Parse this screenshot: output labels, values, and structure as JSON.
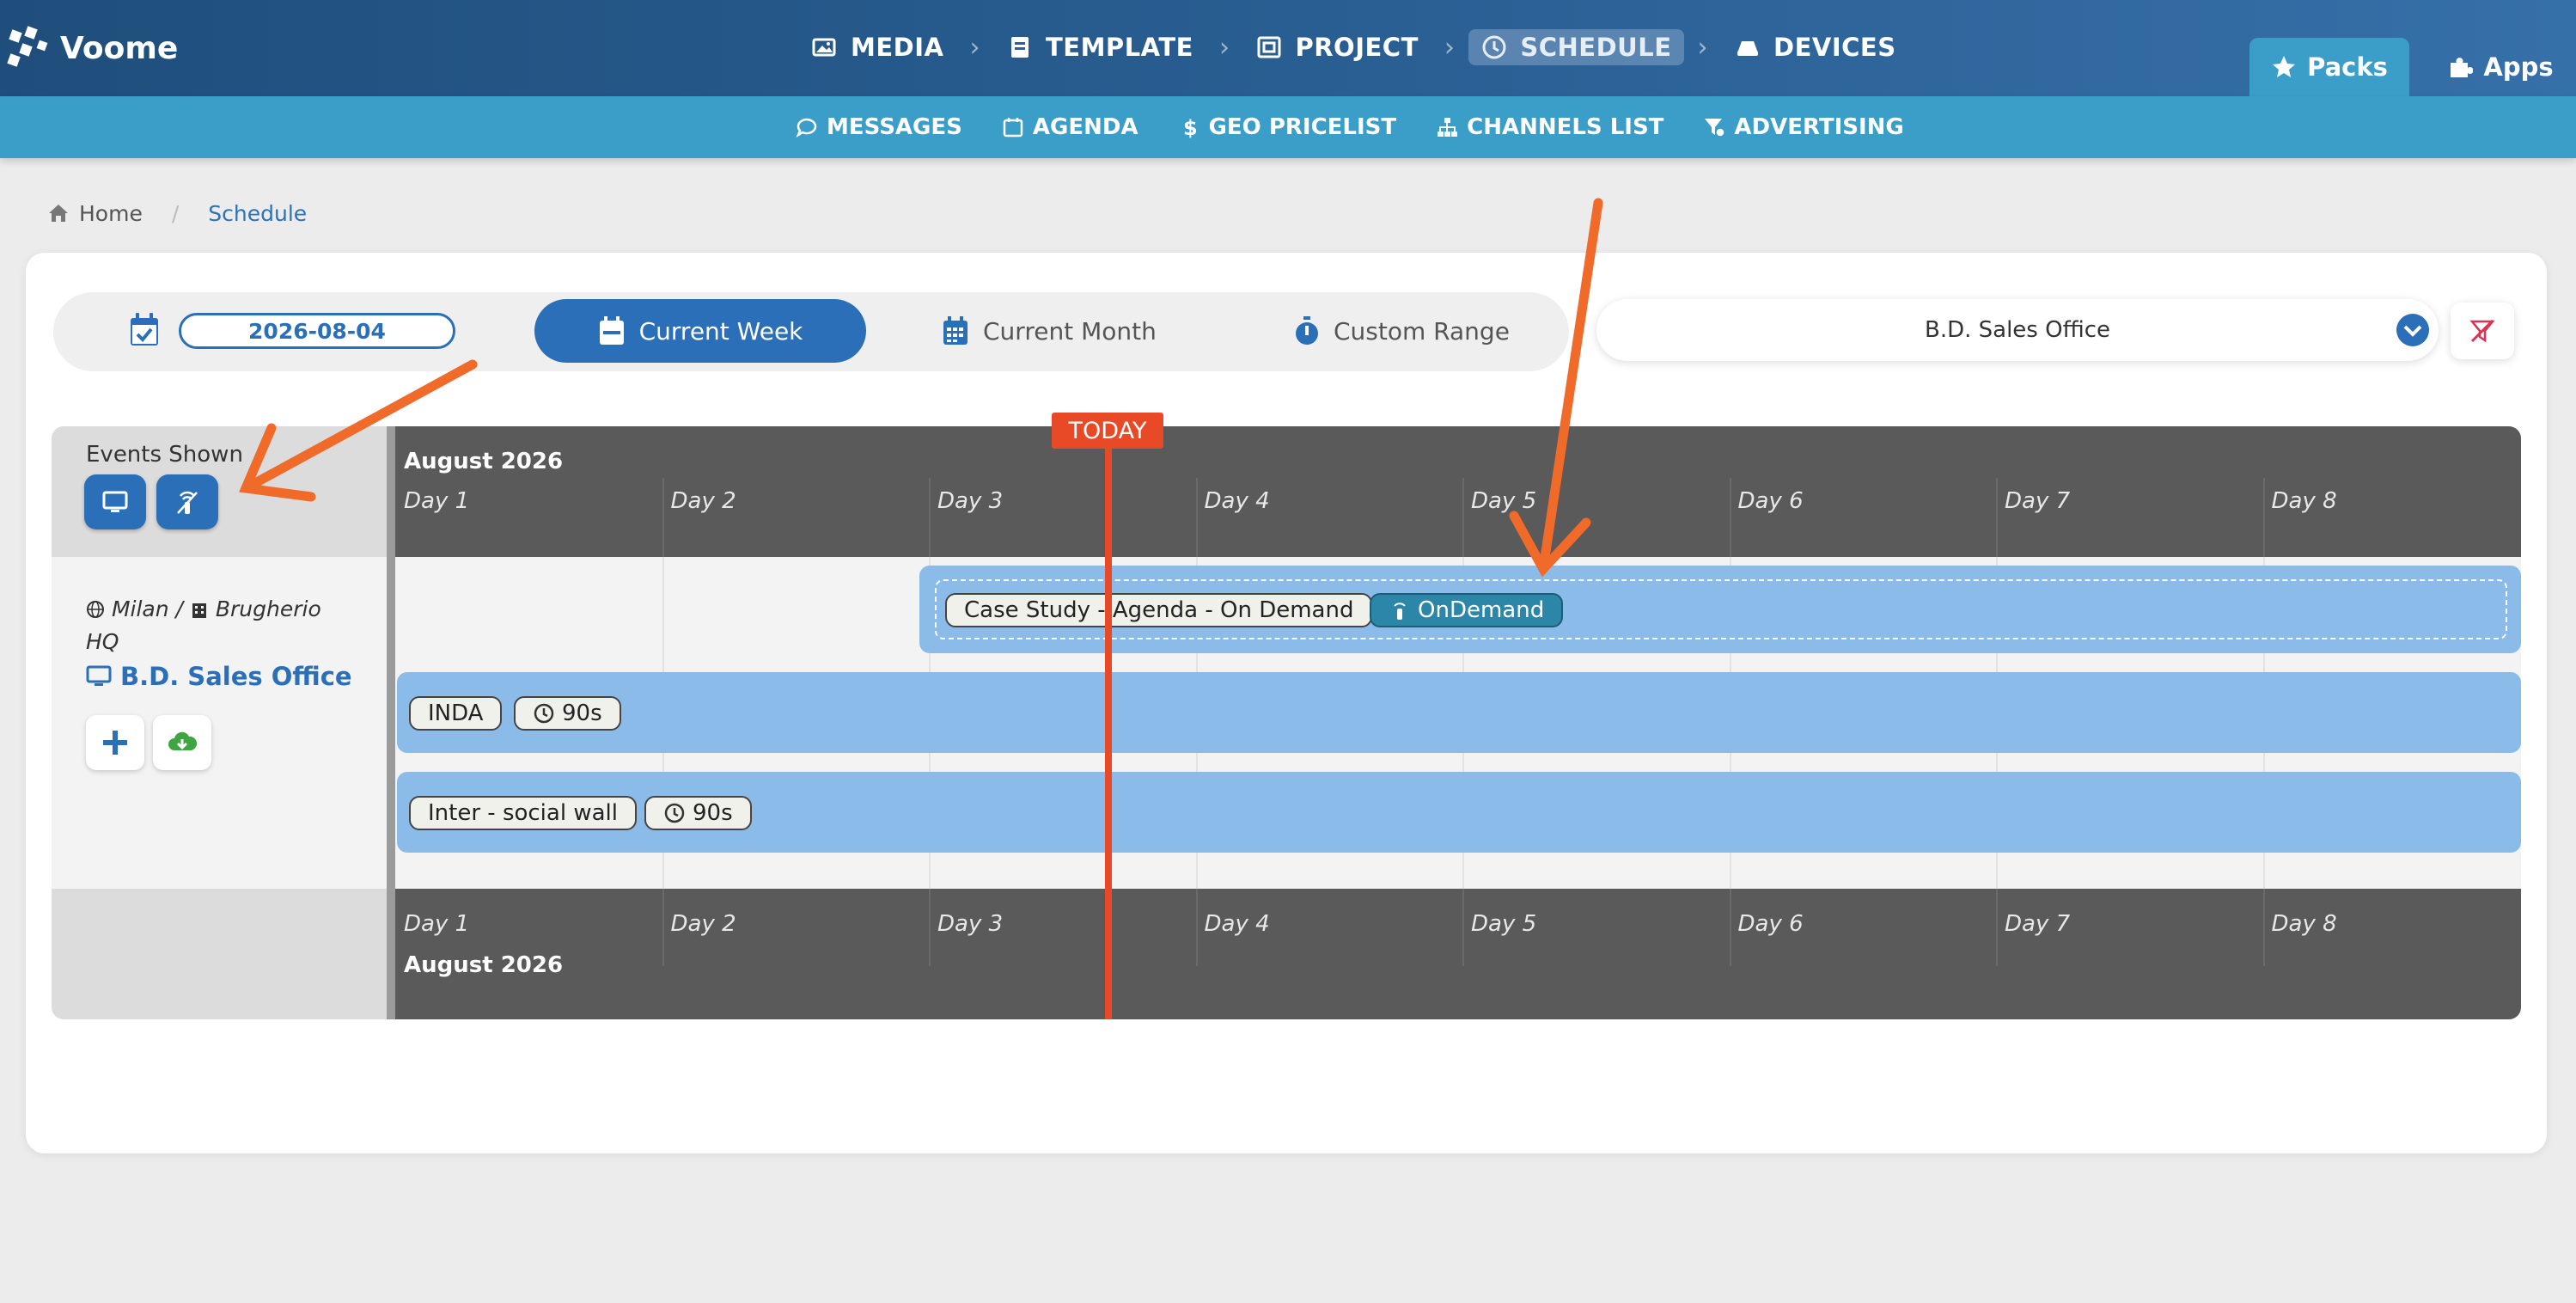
{
  "app": {
    "logo_text": "Voome"
  },
  "mainnav": {
    "media": "MEDIA",
    "template": "TEMPLATE",
    "project": "PROJECT",
    "schedule": "SCHEDULE",
    "devices": "DEVICES",
    "separator": "›"
  },
  "tabs": {
    "packs": "Packs",
    "apps": "Apps"
  },
  "subnav": {
    "messages": "MESSAGES",
    "agenda": "AGENDA",
    "geo_pricelist": "GEO PRICELIST",
    "channels_list": "CHANNELS LIST",
    "advertising": "ADVERTISING"
  },
  "breadcrumb": {
    "home": "Home",
    "separator": "/",
    "current": "Schedule"
  },
  "toolbar": {
    "date": "2026-08-04",
    "current_week": "Current Week",
    "current_month": "Current Month",
    "custom_range": "Custom Range",
    "device_selected": "B.D. Sales Office"
  },
  "sidebar": {
    "events_shown": "Events Shown",
    "location_city": "Milan /",
    "location_site": "Brugherio HQ",
    "device_name": "B.D. Sales Office"
  },
  "timeline": {
    "month": "August 2026",
    "days": [
      "Day 1",
      "Day 2",
      "Day 3",
      "Day 4",
      "Day 5",
      "Day 6",
      "Day 7",
      "Day 8"
    ],
    "today_label": "TODAY",
    "rows": [
      {
        "title": "Case Study - Agenda - On Demand",
        "tag": "OnDemand"
      },
      {
        "title": "INDA",
        "duration": "90s"
      },
      {
        "title": "Inter - social wall",
        "duration": "90s"
      }
    ]
  },
  "colors": {
    "nav_dark": "#1f4e7c",
    "nav_light": "#3a9ec8",
    "primary": "#2a6fb8",
    "event_bar": "#8bbbe8",
    "today": "#e84a27",
    "annotation_arrow": "#f06a2a"
  }
}
